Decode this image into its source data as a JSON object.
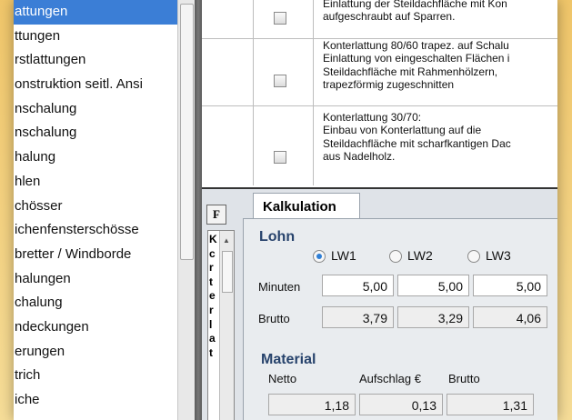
{
  "left_list": [
    "attungen",
    "ttungen",
    "rstlattungen",
    "onstruktion seitl. Ansi",
    "nschalung",
    "nschalung",
    "halung",
    "hlen",
    "chösser",
    "ichenfensterschösse",
    "bretter / Windborde",
    "halungen",
    "chalung",
    "ndeckungen",
    "erungen",
    "trich",
    "iche"
  ],
  "grid_rows": [
    {
      "lines": [
        "Einlattung der Steildachfläche mit  Kon",
        "aufgeschraubt auf Sparren."
      ],
      "checked": false
    },
    {
      "lines": [
        "Konterlattung 80/60 trapez. auf Schalu",
        "Einlattung von eingeschalten Flächen i",
        "Steildachfläche mit Rahmenhölzern,",
        "trapezförmig zugeschnitten"
      ],
      "checked": false
    },
    {
      "lines": [
        "Konterlattung 30/70:",
        "Einbau von Konterlattung auf die",
        "Steildachfläche mit scharfkantigen Dac",
        "aus Nadelholz."
      ],
      "checked": false
    }
  ],
  "f_button": "F",
  "mini_letters": [
    "K",
    "c",
    "r",
    "t",
    "e",
    "r",
    "l",
    "a",
    "t"
  ],
  "tab": {
    "label": "Kalkulation"
  },
  "lohn": {
    "title": "Lohn",
    "options": [
      {
        "label": "LW1",
        "selected": true
      },
      {
        "label": "LW2",
        "selected": false
      },
      {
        "label": "LW3",
        "selected": false
      }
    ],
    "minuten": {
      "label": "Minuten",
      "values": [
        "5,00",
        "5,00",
        "5,00"
      ]
    },
    "brutto": {
      "label": "Brutto",
      "values": [
        "3,79",
        "3,29",
        "4,06"
      ]
    }
  },
  "material": {
    "title": "Material",
    "headers": [
      "Netto",
      "Aufschlag €",
      "Brutto"
    ],
    "values": [
      "1,18",
      "0,13",
      "1,31"
    ]
  },
  "colors": {
    "selection": "#3b7ed6",
    "section_title": "#27436c",
    "background": "#f3d07e"
  }
}
